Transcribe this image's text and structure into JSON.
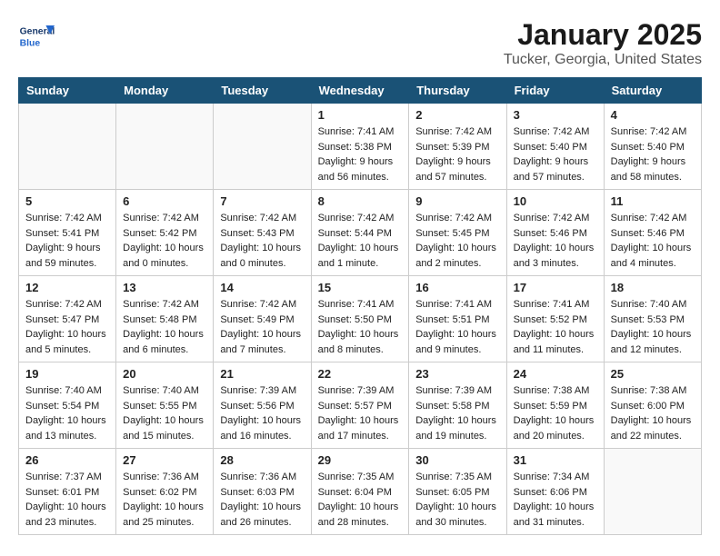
{
  "header": {
    "logo_general": "General",
    "logo_blue": "Blue",
    "month_title": "January 2025",
    "location": "Tucker, Georgia, United States"
  },
  "weekdays": [
    "Sunday",
    "Monday",
    "Tuesday",
    "Wednesday",
    "Thursday",
    "Friday",
    "Saturday"
  ],
  "weeks": [
    [
      {
        "day": "",
        "sunrise": "",
        "sunset": "",
        "daylight": ""
      },
      {
        "day": "",
        "sunrise": "",
        "sunset": "",
        "daylight": ""
      },
      {
        "day": "",
        "sunrise": "",
        "sunset": "",
        "daylight": ""
      },
      {
        "day": "1",
        "sunrise": "Sunrise: 7:41 AM",
        "sunset": "Sunset: 5:38 PM",
        "daylight": "Daylight: 9 hours and 56 minutes."
      },
      {
        "day": "2",
        "sunrise": "Sunrise: 7:42 AM",
        "sunset": "Sunset: 5:39 PM",
        "daylight": "Daylight: 9 hours and 57 minutes."
      },
      {
        "day": "3",
        "sunrise": "Sunrise: 7:42 AM",
        "sunset": "Sunset: 5:40 PM",
        "daylight": "Daylight: 9 hours and 57 minutes."
      },
      {
        "day": "4",
        "sunrise": "Sunrise: 7:42 AM",
        "sunset": "Sunset: 5:40 PM",
        "daylight": "Daylight: 9 hours and 58 minutes."
      }
    ],
    [
      {
        "day": "5",
        "sunrise": "Sunrise: 7:42 AM",
        "sunset": "Sunset: 5:41 PM",
        "daylight": "Daylight: 9 hours and 59 minutes."
      },
      {
        "day": "6",
        "sunrise": "Sunrise: 7:42 AM",
        "sunset": "Sunset: 5:42 PM",
        "daylight": "Daylight: 10 hours and 0 minutes."
      },
      {
        "day": "7",
        "sunrise": "Sunrise: 7:42 AM",
        "sunset": "Sunset: 5:43 PM",
        "daylight": "Daylight: 10 hours and 0 minutes."
      },
      {
        "day": "8",
        "sunrise": "Sunrise: 7:42 AM",
        "sunset": "Sunset: 5:44 PM",
        "daylight": "Daylight: 10 hours and 1 minute."
      },
      {
        "day": "9",
        "sunrise": "Sunrise: 7:42 AM",
        "sunset": "Sunset: 5:45 PM",
        "daylight": "Daylight: 10 hours and 2 minutes."
      },
      {
        "day": "10",
        "sunrise": "Sunrise: 7:42 AM",
        "sunset": "Sunset: 5:46 PM",
        "daylight": "Daylight: 10 hours and 3 minutes."
      },
      {
        "day": "11",
        "sunrise": "Sunrise: 7:42 AM",
        "sunset": "Sunset: 5:46 PM",
        "daylight": "Daylight: 10 hours and 4 minutes."
      }
    ],
    [
      {
        "day": "12",
        "sunrise": "Sunrise: 7:42 AM",
        "sunset": "Sunset: 5:47 PM",
        "daylight": "Daylight: 10 hours and 5 minutes."
      },
      {
        "day": "13",
        "sunrise": "Sunrise: 7:42 AM",
        "sunset": "Sunset: 5:48 PM",
        "daylight": "Daylight: 10 hours and 6 minutes."
      },
      {
        "day": "14",
        "sunrise": "Sunrise: 7:42 AM",
        "sunset": "Sunset: 5:49 PM",
        "daylight": "Daylight: 10 hours and 7 minutes."
      },
      {
        "day": "15",
        "sunrise": "Sunrise: 7:41 AM",
        "sunset": "Sunset: 5:50 PM",
        "daylight": "Daylight: 10 hours and 8 minutes."
      },
      {
        "day": "16",
        "sunrise": "Sunrise: 7:41 AM",
        "sunset": "Sunset: 5:51 PM",
        "daylight": "Daylight: 10 hours and 9 minutes."
      },
      {
        "day": "17",
        "sunrise": "Sunrise: 7:41 AM",
        "sunset": "Sunset: 5:52 PM",
        "daylight": "Daylight: 10 hours and 11 minutes."
      },
      {
        "day": "18",
        "sunrise": "Sunrise: 7:40 AM",
        "sunset": "Sunset: 5:53 PM",
        "daylight": "Daylight: 10 hours and 12 minutes."
      }
    ],
    [
      {
        "day": "19",
        "sunrise": "Sunrise: 7:40 AM",
        "sunset": "Sunset: 5:54 PM",
        "daylight": "Daylight: 10 hours and 13 minutes."
      },
      {
        "day": "20",
        "sunrise": "Sunrise: 7:40 AM",
        "sunset": "Sunset: 5:55 PM",
        "daylight": "Daylight: 10 hours and 15 minutes."
      },
      {
        "day": "21",
        "sunrise": "Sunrise: 7:39 AM",
        "sunset": "Sunset: 5:56 PM",
        "daylight": "Daylight: 10 hours and 16 minutes."
      },
      {
        "day": "22",
        "sunrise": "Sunrise: 7:39 AM",
        "sunset": "Sunset: 5:57 PM",
        "daylight": "Daylight: 10 hours and 17 minutes."
      },
      {
        "day": "23",
        "sunrise": "Sunrise: 7:39 AM",
        "sunset": "Sunset: 5:58 PM",
        "daylight": "Daylight: 10 hours and 19 minutes."
      },
      {
        "day": "24",
        "sunrise": "Sunrise: 7:38 AM",
        "sunset": "Sunset: 5:59 PM",
        "daylight": "Daylight: 10 hours and 20 minutes."
      },
      {
        "day": "25",
        "sunrise": "Sunrise: 7:38 AM",
        "sunset": "Sunset: 6:00 PM",
        "daylight": "Daylight: 10 hours and 22 minutes."
      }
    ],
    [
      {
        "day": "26",
        "sunrise": "Sunrise: 7:37 AM",
        "sunset": "Sunset: 6:01 PM",
        "daylight": "Daylight: 10 hours and 23 minutes."
      },
      {
        "day": "27",
        "sunrise": "Sunrise: 7:36 AM",
        "sunset": "Sunset: 6:02 PM",
        "daylight": "Daylight: 10 hours and 25 minutes."
      },
      {
        "day": "28",
        "sunrise": "Sunrise: 7:36 AM",
        "sunset": "Sunset: 6:03 PM",
        "daylight": "Daylight: 10 hours and 26 minutes."
      },
      {
        "day": "29",
        "sunrise": "Sunrise: 7:35 AM",
        "sunset": "Sunset: 6:04 PM",
        "daylight": "Daylight: 10 hours and 28 minutes."
      },
      {
        "day": "30",
        "sunrise": "Sunrise: 7:35 AM",
        "sunset": "Sunset: 6:05 PM",
        "daylight": "Daylight: 10 hours and 30 minutes."
      },
      {
        "day": "31",
        "sunrise": "Sunrise: 7:34 AM",
        "sunset": "Sunset: 6:06 PM",
        "daylight": "Daylight: 10 hours and 31 minutes."
      },
      {
        "day": "",
        "sunrise": "",
        "sunset": "",
        "daylight": ""
      }
    ]
  ]
}
